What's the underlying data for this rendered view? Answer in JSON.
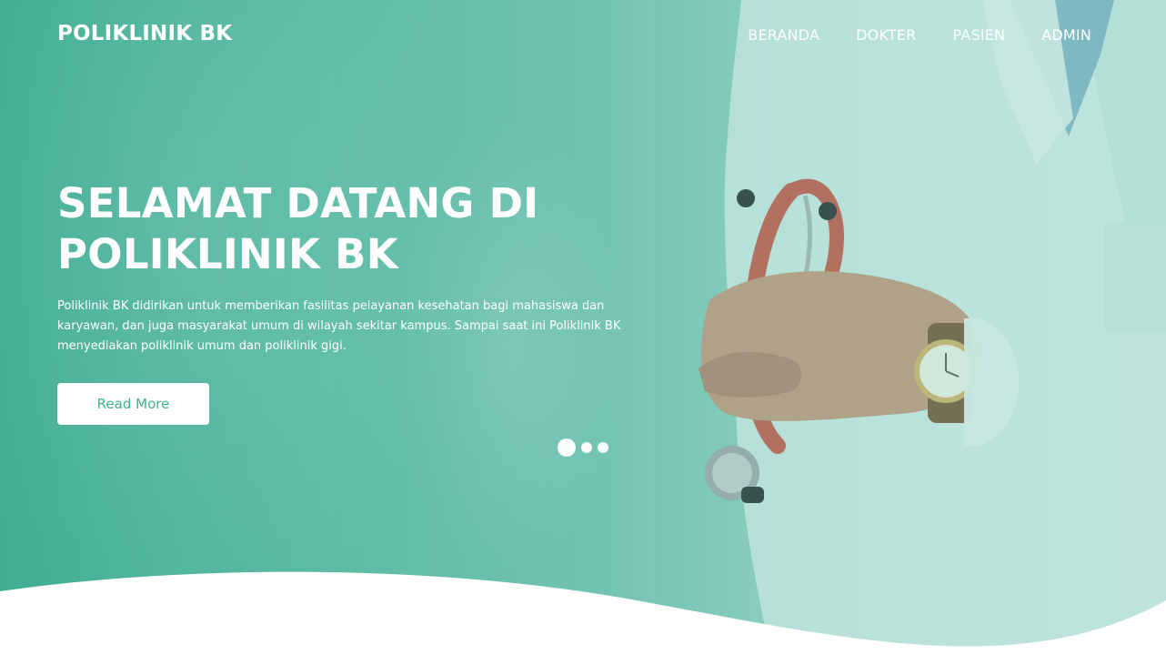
{
  "brand": {
    "name": "POLIKLINIK BK"
  },
  "nav": {
    "items": [
      {
        "label": "BERANDA"
      },
      {
        "label": "DOKTER"
      },
      {
        "label": "PASIEN"
      },
      {
        "label": "ADMIN"
      }
    ]
  },
  "hero": {
    "title": "SELAMAT DATANG DI POLIKLINIK BK",
    "description": "Poliklinik BK didirikan untuk memberikan fasilitas pelayanan kesehatan bagi mahasiswa dan karyawan, dan juga masyarakat umum di wilayah sekitar kampus. Sampai saat ini Poliklinik BK menyediakan poliklinik umum dan poliklinik gigi.",
    "button_label": "Read More",
    "carousel": {
      "slide_count": 3,
      "active_slide": 1
    }
  },
  "colors": {
    "primary_teal": "#41ad93",
    "button_text": "#3fb38f",
    "white": "#ffffff"
  },
  "icons": {
    "carousel_indicator": "dot-icon"
  }
}
